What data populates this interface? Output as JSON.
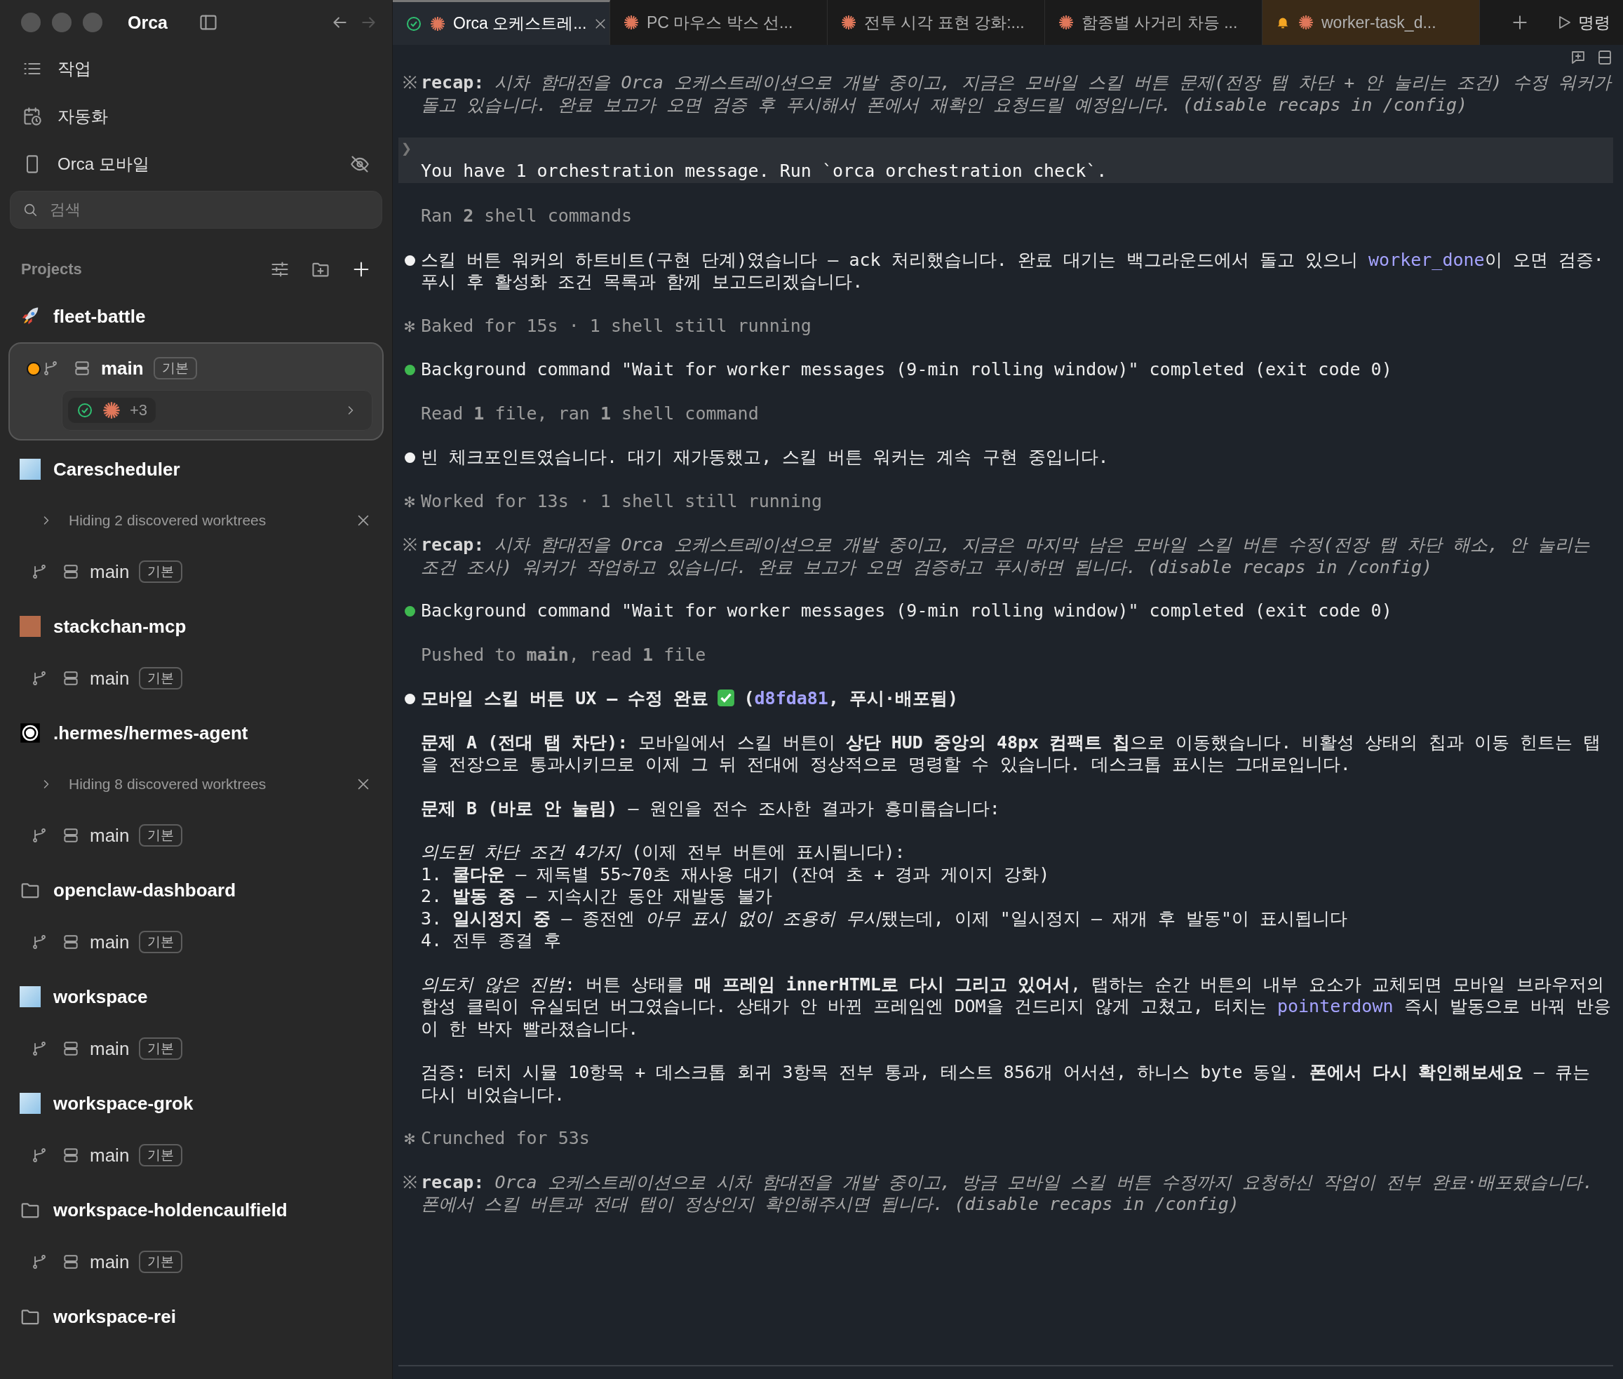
{
  "window": {
    "title": "Orca",
    "back_enabled": true,
    "forward_enabled": false
  },
  "sidebar": {
    "nav": [
      {
        "kind": "list",
        "label": "작업"
      },
      {
        "kind": "calendar",
        "label": "자동화"
      },
      {
        "kind": "phone",
        "label": "Orca 모바일",
        "hidden": true
      }
    ],
    "search": {
      "placeholder": "검색"
    },
    "projects_header": "Projects",
    "projects": [
      {
        "name": "fleet-battle",
        "kind": "rocket",
        "worktrees": [
          {
            "branch": "main",
            "badge": "기본",
            "selected": true,
            "unread": true,
            "agents": {
              "extra": "+3"
            }
          }
        ]
      },
      {
        "name": "Carescheduler",
        "kind": "image",
        "hidden_note": "Hiding 2 discovered worktrees",
        "worktrees": [
          {
            "branch": "main",
            "badge": "기본",
            "selected": false,
            "unread": false
          }
        ]
      },
      {
        "name": "stackchan-mcp",
        "kind": "avatar",
        "worktrees": [
          {
            "branch": "main",
            "badge": "기본",
            "selected": false,
            "unread": false
          }
        ]
      },
      {
        "name": ".hermes/hermes-agent",
        "kind": "logo",
        "hidden_note": "Hiding 8 discovered worktrees",
        "worktrees": [
          {
            "branch": "main",
            "badge": "기본",
            "selected": false,
            "unread": false
          }
        ]
      },
      {
        "name": "openclaw-dashboard",
        "kind": "folder",
        "worktrees": [
          {
            "branch": "main",
            "badge": "기본",
            "selected": false,
            "unread": false
          }
        ]
      },
      {
        "name": "workspace",
        "kind": "image",
        "worktrees": [
          {
            "branch": "main",
            "badge": "기본",
            "selected": false,
            "unread": false
          }
        ]
      },
      {
        "name": "workspace-grok",
        "kind": "image",
        "worktrees": [
          {
            "branch": "main",
            "badge": "기본",
            "selected": false,
            "unread": false
          }
        ]
      },
      {
        "name": "workspace-holdencaulfield",
        "kind": "folder",
        "worktrees": [
          {
            "branch": "main",
            "badge": "기본",
            "selected": false,
            "unread": false
          }
        ]
      },
      {
        "name": "workspace-rei",
        "kind": "folder"
      }
    ]
  },
  "tabs": [
    {
      "label": "Orca 오케스트레...",
      "selected": true,
      "kind": "done"
    },
    {
      "label": "PC 마우스 박스 선...",
      "selected": false,
      "kind": "plain"
    },
    {
      "label": "전투 시각 표현 강화:...",
      "selected": false,
      "kind": "plain"
    },
    {
      "label": "함종별 사거리 차등 ...",
      "selected": false,
      "kind": "plain"
    },
    {
      "label": "worker-task_d...",
      "selected": false,
      "kind": "alert"
    }
  ],
  "command_button": "명령",
  "terminal": [
    {
      "kind": "recap",
      "marker": "※",
      "label": "recap:",
      "text": "시차 함대전을 Orca 오케스트레이션으로 개발 중이고, 지금은 모바일 스킬 버튼 문제(전장 탭 차단 + 안 눌리는 조건) 수정 워커가 돌고 있습니다. 완료 보고가 오면 검증 후 푸시해서 폰에서 재확인 요청드릴 예정입니다. (disable recaps in /config)"
    },
    {
      "kind": "prompt",
      "marker": "❯",
      "text": "You have 1 orchestration message. Run `orca orchestration check`."
    },
    {
      "kind": "summary",
      "text": "Ran **2** shell commands"
    },
    {
      "kind": "message",
      "color": "#f2f2f2",
      "paragraphs": [
        [
          [
            "스킬 버튼 워커의 하트비트(구현 단계)였습니다 — ack 처리했습니다. 완료 대기는 백그라운드에서 돌고 있으니 ",
            {
              "kind": "code",
              "text": "worker_done"
            },
            "이 오면 검증·푸시 후 활성화 조건 목록과 함께 보고드리겠습니다."
          ]
        ]
      ]
    },
    {
      "kind": "status",
      "marker": "✻",
      "text": "Baked for 15s · 1 shell still running"
    },
    {
      "kind": "message",
      "color": "#3fb950",
      "paragraphs": [
        [
          [
            "Background command \"Wait for worker messages (9-min rolling window)\" completed (exit code 0)"
          ]
        ]
      ]
    },
    {
      "kind": "summary",
      "text": "Read **1** file, ran **1** shell command"
    },
    {
      "kind": "message",
      "color": "#f2f2f2",
      "paragraphs": [
        [
          [
            "빈 체크포인트였습니다. 대기 재가동했고, 스킬 버튼 워커는 계속 구현 중입니다."
          ]
        ]
      ]
    },
    {
      "kind": "status",
      "marker": "✻",
      "text": "Worked for 13s · 1 shell still running"
    },
    {
      "kind": "recap",
      "marker": "※",
      "label": "recap:",
      "text": "시차 함대전을 Orca 오케스트레이션으로 개발 중이고, 지금은 마지막 남은 모바일 스킬 버튼 수정(전장 탭 차단 해소, 안 눌리는 조건 조사) 워커가 작업하고 있습니다. 완료 보고가 오면 검증하고 푸시하면 됩니다. (disable recaps in /config)"
    },
    {
      "kind": "message",
      "color": "#3fb950",
      "paragraphs": [
        [
          [
            "Background command \"Wait for worker messages (9-min rolling window)\" completed (exit code 0)"
          ]
        ]
      ]
    },
    {
      "kind": "summary",
      "text": "Pushed to **main**, read **1** file"
    },
    {
      "kind": "message",
      "color": "#f2f2f2",
      "paragraphs": [
        [
          [
            "**모바일 스킬 버튼 UX — 수정 완료**",
            {
              "kind": "check"
            },
            "**(**",
            {
              "kind": "code",
              "text": "**d8fda81**"
            },
            "**, 푸시·배포됨)**"
          ]
        ],
        [
          [
            "**문제 A (전대 탭 차단):** 모바일에서 스킬 버튼이 **상단 HUD 중앙의 48px 컴팩트 칩**으로 이동했습니다. 비활성 상태의 칩과 이동 힌트는 탭을 전장으로 통과시키므로 이제 그 뒤 전대에 정상적으로 명령할 수 있습니다. 데스크톱 표시는 그대로입니다."
          ]
        ],
        [
          [
            "**문제 B (바로 안 눌림)** — 원인을 전수 조사한 결과가 흥미롭습니다:"
          ]
        ],
        [
          [
            "*의도된 차단 조건 4가지* (이제 전부 버튼에 표시됩니다):"
          ],
          [
            "1. **쿨다운** — 제독별 55~70초 재사용 대기 (잔여 초 + 경과 게이지 강화)"
          ],
          [
            "2. **발동 중** — 지속시간 동안 재발동 불가"
          ],
          [
            "3. **일시정지 중** — 종전엔 ",
            "*아무 표시 없이 조용히 무시*",
            "됐는데, 이제 \"일시정지 — 재개 후 발동\"이 표시됩니다"
          ],
          [
            "4. 전투 종결 후"
          ]
        ],
        [
          [
            "*의도치 않은 진범*: 버튼 상태를 **매 프레임 innerHTML로 다시 그리고 있어서**, 탭하는 순간 버튼의 내부 요소가 교체되면 모바일 브라우저의 합성 클릭이 유실되던 버그였습니다. 상태가 안 바뀐 프레임엔 DOM을 건드리지 않게 고쳤고, 터치는 ",
            {
              "kind": "code",
              "text": "pointerdown"
            },
            " 즉시 발동으로 바꿔 반응이 한 박자 빨라졌습니다."
          ]
        ],
        [
          [
            "검증: 터치 시뮬 10항목 + 데스크톱 회귀 3항목 전부 통과, 테스트 856개 어서션, 하니스 byte 동일. **폰에서 다시 확인해보세요** — 큐는 다시 비었습니다."
          ]
        ]
      ]
    },
    {
      "kind": "status",
      "marker": "✻",
      "text": "Crunched for 53s"
    },
    {
      "kind": "recap",
      "marker": "※",
      "label": "recap:",
      "text": "Orca 오케스트레이션으로 시차 함대전을 개발 중이고, 방금 모바일 스킬 버튼 수정까지 요청하신 작업이 전부 완료·배포됐습니다. 폰에서 스킬 버튼과 전대 탭이 정상인지 확인해주시면 됩니다. (disable recaps in /config)"
    }
  ]
}
